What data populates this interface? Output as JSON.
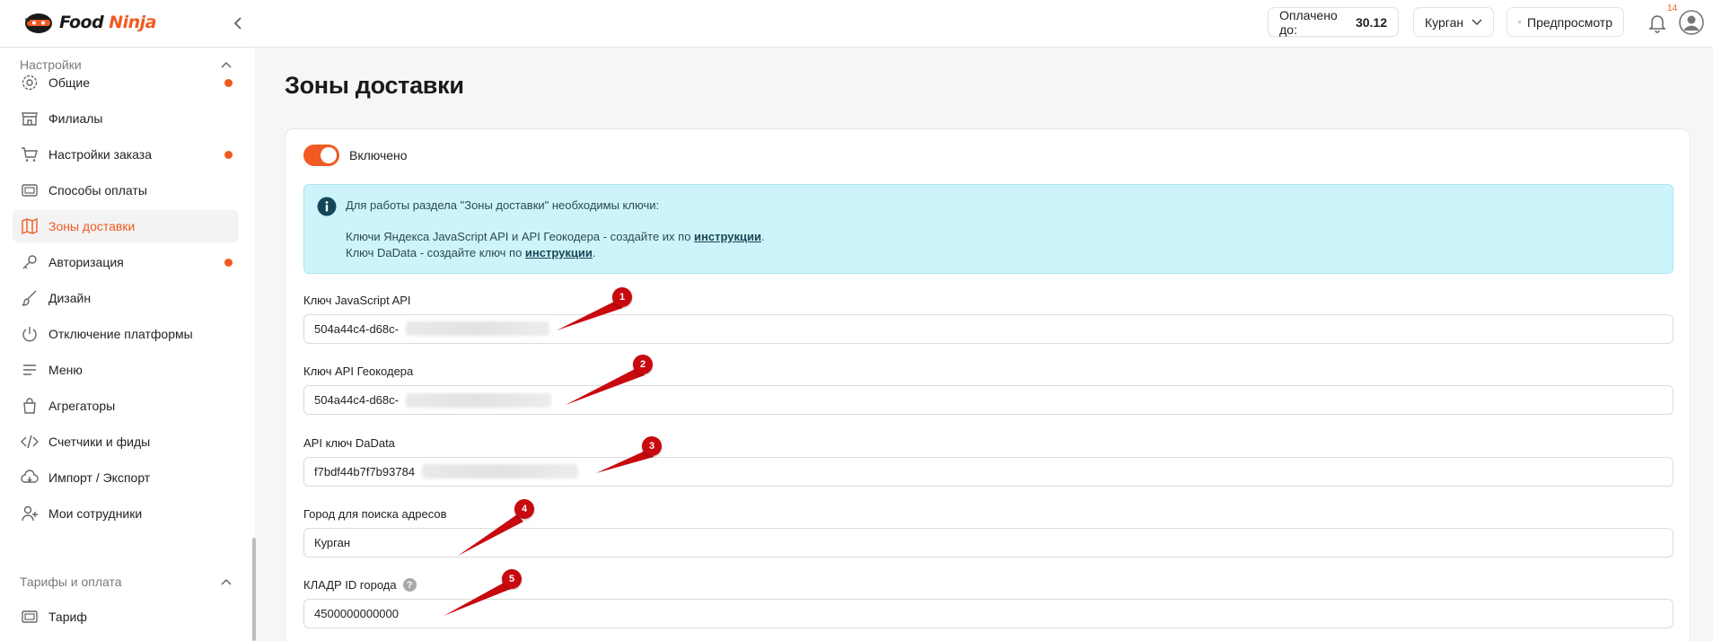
{
  "brand": {
    "name_part1": "Food",
    "name_part2": "Ninja"
  },
  "header": {
    "paid_label": "Оплачено до:",
    "paid_date": "30.12",
    "city": "Курган",
    "preview_label": "Предпросмотр",
    "notifications_count": "14"
  },
  "sidebar": {
    "settings_section": "Настройки",
    "items": [
      {
        "label": "Общие",
        "icon": "gear-icon",
        "dot": true
      },
      {
        "label": "Филиалы",
        "icon": "store-icon",
        "dot": false
      },
      {
        "label": "Настройки заказа",
        "icon": "cart-icon",
        "dot": true
      },
      {
        "label": "Способы оплаты",
        "icon": "payment-icon",
        "dot": false
      },
      {
        "label": "Зоны доставки",
        "icon": "map-icon",
        "dot": false,
        "active": true
      },
      {
        "label": "Авторизация",
        "icon": "key-icon",
        "dot": true
      },
      {
        "label": "Дизайн",
        "icon": "brush-icon",
        "dot": false
      },
      {
        "label": "Отключение платформы",
        "icon": "power-icon",
        "dot": false
      },
      {
        "label": "Меню",
        "icon": "menu-icon",
        "dot": false
      },
      {
        "label": "Агрегаторы",
        "icon": "bag-icon",
        "dot": false
      },
      {
        "label": "Счетчики и фиды",
        "icon": "code-icon",
        "dot": false
      },
      {
        "label": "Импорт / Экспорт",
        "icon": "cloud-icon",
        "dot": false
      },
      {
        "label": "Мои сотрудники",
        "icon": "user-add-icon",
        "dot": false
      }
    ],
    "tariffs_section": "Тарифы и оплата",
    "tariff_items": [
      {
        "label": "Тариф",
        "icon": "tariff-icon"
      }
    ]
  },
  "main": {
    "title": "Зоны доставки",
    "enabled_label": "Включено",
    "enabled": true,
    "info": {
      "line1": "Для работы раздела \"Зоны доставки\" необходимы ключи:",
      "line2_prefix": "Ключи Яндекса JavaScript API и API Геокодера - создайте их по ",
      "line3_prefix": "Ключ DaData - создайте ключ по ",
      "link": "инструкции",
      "suffix": "."
    },
    "fields": [
      {
        "label": "Ключ JavaScript API",
        "value": "504a44c4-d68c-"
      },
      {
        "label": "Ключ API Геокодера",
        "value": "504a44c4-d68c-"
      },
      {
        "label": "API ключ DaData",
        "value": "f7bdf44b7f7b93784"
      },
      {
        "label": "Город для поиска адресов",
        "value": "Курган"
      },
      {
        "label": "КЛАДР ID города",
        "value": "4500000000000",
        "help": "?"
      }
    ]
  },
  "annotations": [
    "1",
    "2",
    "3",
    "4",
    "5"
  ],
  "colors": {
    "accent": "#f05a22",
    "info_bg": "#cdf4fa",
    "annotation": "#c8090e"
  }
}
